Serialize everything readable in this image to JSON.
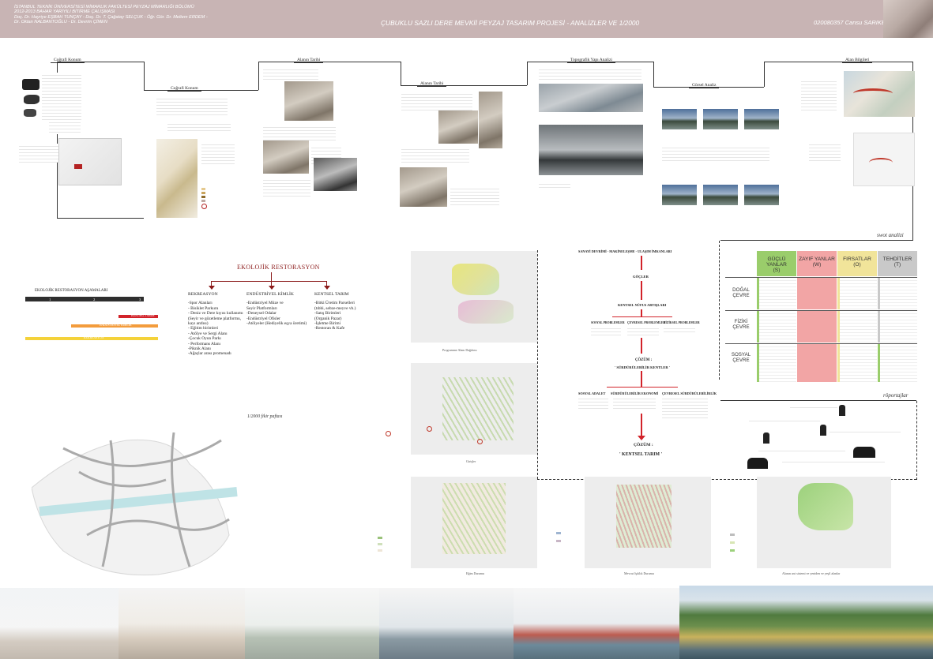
{
  "header": {
    "school_lines": [
      "İSTANBUL TEKNİK ÜNİVERSİTESİ MİMARLIK FAKÜLTESİ PEYZAJ MİMARLIĞI BÖLÜMÜ",
      "2012-2013 BAHAR YARIYILI BİTİRME ÇALIŞMASI",
      "Doç. Dr. Hayriye EŞBAH TUNÇAY - Doç. Dr. T. Çağatay SELÇUK - Öğr. Gör. Dr. Meltem ERDEM -",
      "Dr. Oktan NALBANTOĞLU - Dr. Devrim ÇİMEN"
    ],
    "title": "ÇUBUKLU SAZLI DERE MEVKİİ PEYZAJ TASARIM PROJESİ - ANALİZLER VE 1/2000",
    "student": "020080357 Cansu SARIKEÇE"
  },
  "analysis": {
    "cografi_konum": "Coğrafi Konum",
    "cografi_konum_2": "Coğrafi Konum",
    "alanin_tarihi": "Alanın Tarihi",
    "alanin_tarihi_2": "Alanın Tarihi",
    "topografik": "Topografik Yapı Analizi",
    "gorunurluk": "Görsel Analiz",
    "alan_bilgileri": "Alan Bilgileri",
    "swot_analizi": "swot analizi",
    "roportajlar": "röportajlar"
  },
  "eco": {
    "title": "EKOLOJİK RESTORASYON",
    "col1_title": "REKREASYON",
    "col1_items": [
      "-Spor Alanları",
      "- Bisiklet Parkuru",
      "- Deniz ve Dere kıyısı kullanımı",
      "(Seyir ve gözetleme platformu,",
      "kayı antlısı)",
      "- Eğitim birimleri",
      "- Atölye ve Sergi Alanı",
      "-Çocuk Oyun Parkı",
      "- Performans Alanı",
      "-Piknik Alanı",
      "-Ağaçlar arası promenadı"
    ],
    "col2_title": "ENDÜSTRİYEL KİMLİK",
    "col2_items": [
      "-Endüstriyel Müze ve",
      "Seyir Platformları",
      "-Deneysel Odalar",
      "-Endüstriyel Ofisler",
      "-Atölyeler (Hediyelik eşya üretimi)"
    ],
    "col3_title": "KENTSEL TARIM",
    "col3_items": [
      "-Bitki Üretim Parselleri",
      "(tıbbi, sebze-meyve vb.)",
      "-Satış Birimleri",
      "(Organik Pazar)",
      "-İşletme Birimi",
      "-Restoran & Kafe"
    ],
    "phases_title": "EKOLOJİK RESTORASYON AŞAMALARI",
    "phase_numbers": [
      "1",
      "2",
      "3"
    ],
    "phase_labels": [
      "KENTSEL TARIM",
      "ENDÜSTRİYEL KİMLİK",
      "REKREASYON"
    ],
    "map_caption": "1/2000 fikir paftası"
  },
  "flow": {
    "top": "SANAYİ DEVRİMİ - MAKİNELEŞME - ULAŞIM İMKANLARI",
    "goc": "GÖÇLER",
    "kentsel": "KENTSEL NÜFUS ARTIŞLARI",
    "problems": [
      "SOSYAL PROBLEMLER",
      "ÇEVRESEL PROBLEMLER",
      "FİZİKSEL PROBLEMLER"
    ],
    "cozum1": "ÇÖZÜM :",
    "surdurulebilir": "' SÜRDÜRÜLEBİLİR KENTLER '",
    "pillars": [
      "SOSYAL ADALET",
      "SÜRDÜRÜLEBİLİR EKONOMİ",
      "ÇEVRESEL SÜRDÜRÜLEBİLİRLİK"
    ],
    "cozum2": "ÇÖZÜM :",
    "kentsel_tarim": "' KENTSEL TARIM '"
  },
  "swot": {
    "headers": [
      "GÜÇLÜ YANLAR\n(S)",
      "ZAYIF YANLAR\n(W)",
      "FIRSATLAR\n(O)",
      "TEHDİTLER\n(T)"
    ],
    "rows": [
      "DOĞAL\nÇEVRE",
      "FİZİKİ\nÇEVRE",
      "SOSYAL\nÇEVRE"
    ],
    "colors": [
      "#9acd6b",
      "#f2a5a5",
      "#f1e49a",
      "#c9c9c9"
    ]
  },
  "map_captions": [
    "Programme Alanı Dağılımı",
    "Girişler",
    "Eğim Durumu",
    "Mevcut Işıklık Durumu",
    "Alanın arıt sistemi ve yeniden ve yeşil alanlar"
  ],
  "colors": {
    "header_bg": "#c8b4b4",
    "eco_red": "#8b1a1a",
    "arrow_red": "#d2232a",
    "phase_red": "#d2232a",
    "phase_orange": "#f39c3c",
    "phase_yellow": "#f4d23a"
  }
}
